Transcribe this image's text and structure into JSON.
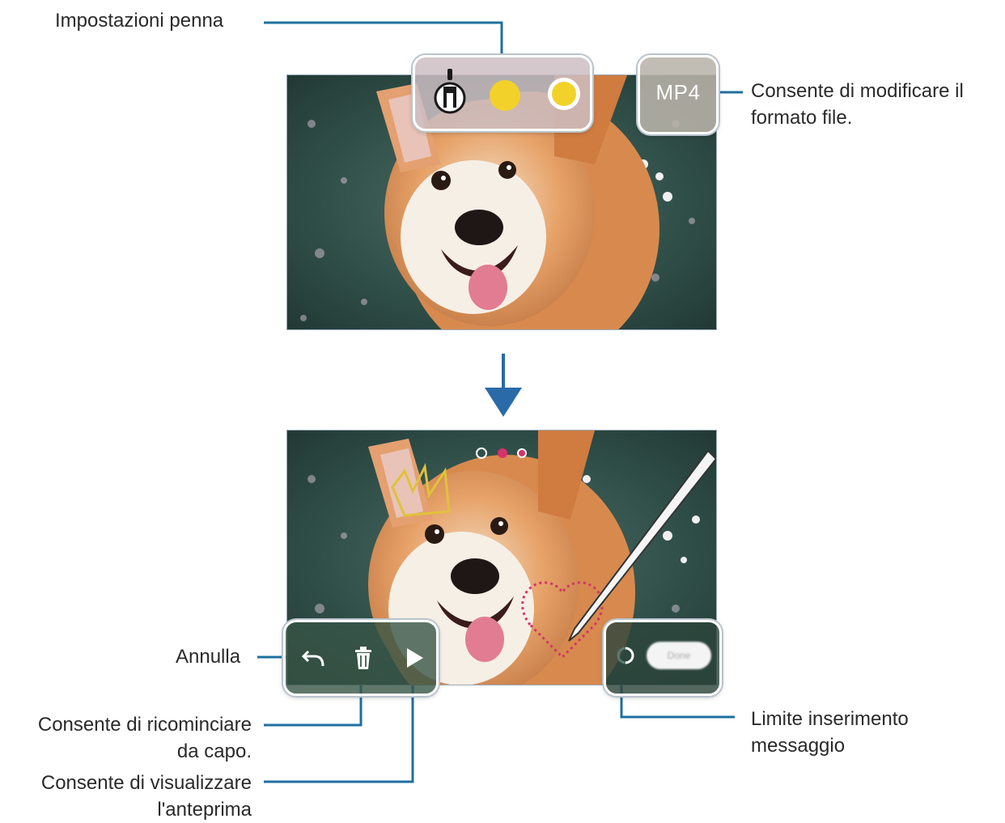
{
  "annotations": {
    "pen_settings": "Impostazioni penna",
    "file_format_line1": "Consente di modificare il",
    "file_format_line2": "formato file.",
    "undo": "Annulla",
    "restart_line1": "Consente di ricominciare",
    "restart_line2": "da capo.",
    "preview_line1": "Consente di visualizzare",
    "preview_line2": "l'anteprima",
    "limit_line1": "Limite inserimento",
    "limit_line2": "messaggio"
  },
  "toolbar": {
    "format_label": "MP4",
    "done_label": "Done"
  },
  "colors": {
    "callout_line": "#1f6fa0",
    "arrow": "#2a6aa8",
    "pen_color": "#f2d22a",
    "drawing_color": "#e0c23a",
    "heart_color": "#d4336a"
  },
  "icons": {
    "pen": "pen-icon",
    "undo": "undo-icon",
    "delete": "trash-icon",
    "play": "play-icon",
    "limit": "spinner-icon",
    "down_arrow": "arrow-down-icon"
  }
}
